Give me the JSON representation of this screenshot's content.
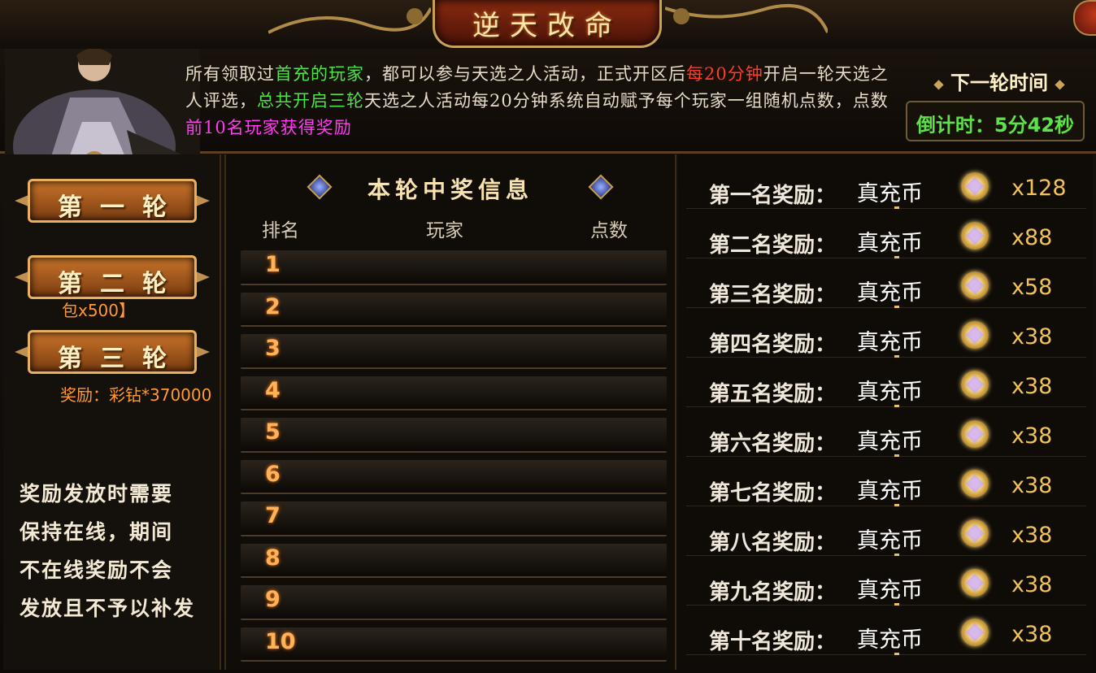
{
  "window": {
    "title": "逆天改命"
  },
  "header": {
    "description_segments": [
      {
        "text": "所有领取过",
        "color": "normal"
      },
      {
        "text": "首充的玩家",
        "color": "green"
      },
      {
        "text": "，都可以参与天选之人活动，正式开区后",
        "color": "normal"
      },
      {
        "text": "每20分钟",
        "color": "red"
      },
      {
        "text": "开启一轮天选之人评选，",
        "color": "normal"
      },
      {
        "text": "总共开启三轮",
        "color": "green"
      },
      {
        "text": "天选之人活动每20分钟系统自动赋予每个玩家一组随机点数，点数",
        "color": "normal"
      },
      {
        "text": "前10名玩家获得奖励",
        "color": "pink"
      }
    ],
    "next_round_label": "下一轮时间",
    "countdown": "倒计时：5分42秒"
  },
  "rounds": [
    {
      "label": "第一轮"
    },
    {
      "label": "第二轮"
    },
    {
      "label": "第三轮"
    }
  ],
  "leaked_texts": {
    "round2": "包x500】",
    "round3": "奖励：彩钻*370000"
  },
  "notice": [
    "奖励发放时需要",
    "保持在线，期间",
    "不在线奖励不会",
    "发放且不予以补发"
  ],
  "ranking": {
    "title": "本轮中奖信息",
    "columns": [
      "排名",
      "玩家",
      "点数"
    ],
    "rows": [
      {
        "rank": "1",
        "player": "",
        "points": ""
      },
      {
        "rank": "2",
        "player": "",
        "points": ""
      },
      {
        "rank": "3",
        "player": "",
        "points": ""
      },
      {
        "rank": "4",
        "player": "",
        "points": ""
      },
      {
        "rank": "5",
        "player": "",
        "points": ""
      },
      {
        "rank": "6",
        "player": "",
        "points": ""
      },
      {
        "rank": "7",
        "player": "",
        "points": ""
      },
      {
        "rank": "8",
        "player": "",
        "points": ""
      },
      {
        "rank": "9",
        "player": "",
        "points": ""
      },
      {
        "rank": "10",
        "player": "",
        "points": ""
      }
    ]
  },
  "rewards": [
    {
      "label": "第一名奖励：",
      "item": "真充币",
      "qty": "x128",
      "icon": "coin-icon"
    },
    {
      "label": "第二名奖励：",
      "item": "真充币",
      "qty": "x88",
      "icon": "coin-icon"
    },
    {
      "label": "第三名奖励：",
      "item": "真充币",
      "qty": "x58",
      "icon": "coin-icon"
    },
    {
      "label": "第四名奖励：",
      "item": "真充币",
      "qty": "x38",
      "icon": "coin-icon"
    },
    {
      "label": "第五名奖励：",
      "item": "真充币",
      "qty": "x38",
      "icon": "coin-icon"
    },
    {
      "label": "第六名奖励：",
      "item": "真充币",
      "qty": "x38",
      "icon": "coin-icon"
    },
    {
      "label": "第七名奖励：",
      "item": "真充币",
      "qty": "x38",
      "icon": "coin-icon"
    },
    {
      "label": "第八名奖励：",
      "item": "真充币",
      "qty": "x38",
      "icon": "coin-icon"
    },
    {
      "label": "第九名奖励：",
      "item": "真充币",
      "qty": "x38",
      "icon": "coin-icon"
    },
    {
      "label": "第十名奖励：",
      "item": "真充币",
      "qty": "x38",
      "icon": "coin-icon"
    }
  ]
}
